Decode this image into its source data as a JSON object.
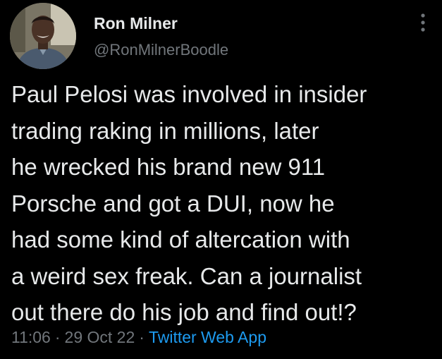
{
  "tweet": {
    "display_name": "Ron Milner",
    "handle": "@RonMilnerBoodle",
    "text": "Paul Pelosi was involved in insider\ntrading raking in millions, later\nhe wrecked his brand new 911\nPorsche and got a DUI, now he\nhad some kind of altercation with\na weird sex freak. Can a journalist\nout there do his job and find out!?",
    "time": "11:06",
    "separator": "·",
    "date": "29 Oct 22",
    "source_app": "Twitter Web App"
  },
  "icons": {
    "more": "more-vertical-icon",
    "avatar": "profile-photo"
  },
  "colors": {
    "background": "#000000",
    "primary_text": "#e7e9ea",
    "secondary_text": "#71767b",
    "link": "#1d9bf0"
  }
}
